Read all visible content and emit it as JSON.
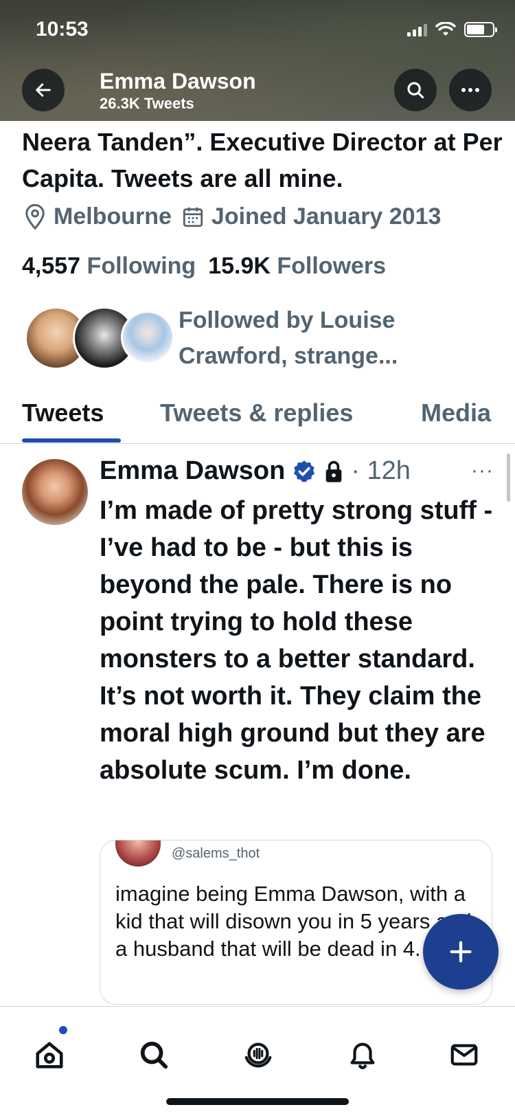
{
  "status_bar": {
    "time": "10:53"
  },
  "header": {
    "name": "Emma Dawson",
    "tweet_count": "26.3K Tweets",
    "back_icon": "arrow-left-icon",
    "search_icon": "search-icon",
    "more_icon": "more-horizontal-icon"
  },
  "profile": {
    "bio": "Neera Tanden”. Executive Director at Per Capita. Tweets are all mine.",
    "location": "Melbourne",
    "joined": "Joined January 2013",
    "following_count": "4,557",
    "following_label": "Following",
    "followers_count": "15.9K",
    "followers_label": "Followers",
    "followed_by": "Followed by Louise Crawford, strange..."
  },
  "tabs": [
    {
      "label": "Tweets",
      "active": true
    },
    {
      "label": "Tweets & replies",
      "active": false
    },
    {
      "label": "Media",
      "active": false
    }
  ],
  "tweet": {
    "author": "Emma Dawson",
    "time": "· 12h",
    "more": "···",
    "text": "I’m made of pretty strong stuff - I’ve had to be - but this is beyond the pale. There is no point trying to hold these monsters to a better standard. It’s not worth it. They claim the moral high ground but they are absolute scum. I’m done.",
    "quote": {
      "handle": "@salems_thot",
      "text": "imagine being Emma Dawson, with a kid that will disown you in 5 years and a  husband that will be dead in 4."
    }
  },
  "fab": {
    "icon": "plus-icon"
  },
  "bottom_nav": [
    {
      "name": "home",
      "icon": "home-icon"
    },
    {
      "name": "search",
      "icon": "search-icon"
    },
    {
      "name": "spaces",
      "icon": "spaces-icon"
    },
    {
      "name": "notifications",
      "icon": "bell-icon"
    },
    {
      "name": "messages",
      "icon": "mail-icon"
    }
  ],
  "colors": {
    "accent": "#1d4fb0",
    "text_primary": "#0f1419",
    "text_secondary": "#536471",
    "fab": "#1d3f8f",
    "verified": "#1d4fb0"
  }
}
